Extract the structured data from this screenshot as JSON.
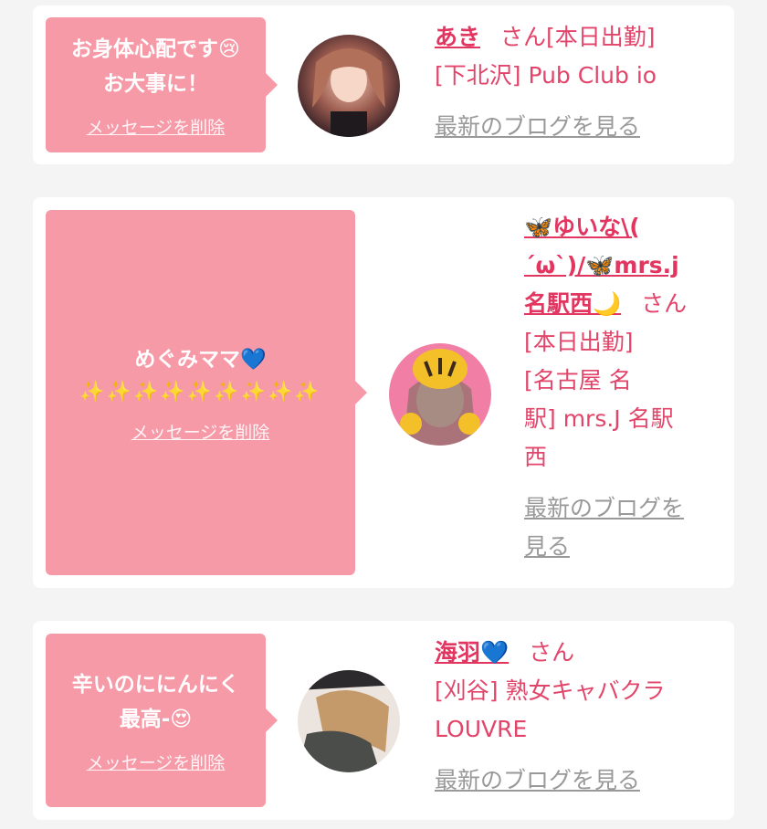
{
  "accent_pink": "#f79aa8",
  "name_color": "#e23560",
  "entries": [
    {
      "message_line1": "お身体心配です😢",
      "message_line2": "お大事に！",
      "delete_label": "メッセージを削除",
      "name": "あき",
      "honorific": "さん",
      "status": "[本日出勤]",
      "shop": "[下北沢] Pub Club io",
      "blog_label": "最新のブログを見る"
    },
    {
      "message_line1": "めぐみママ💙",
      "message_line2": "✨✨✨✨✨✨✨✨✨",
      "delete_label": "メッセージを削除",
      "name_line1": "🦋ゆいな\\(",
      "name_line2": "´ω`)/🦋mrs.j",
      "name_line3": "名駅西🌙",
      "honorific": "さん",
      "status": "[本日出勤]",
      "shop_line1": "[名古屋 名",
      "shop_line2": "駅] mrs.J 名駅",
      "shop_line3": "西",
      "blog_line1": "最新のブログを",
      "blog_line2": "見る"
    },
    {
      "message_line1": "辛いのににんにく",
      "message_line2": "最高-😍",
      "delete_label": "メッセージを削除",
      "name": "海羽💙",
      "honorific": "さん",
      "shop_line1": "[刈谷] 熟女キャバクラ",
      "shop_line2": "LOUVRE",
      "blog_label": "最新のブログを見る"
    }
  ]
}
